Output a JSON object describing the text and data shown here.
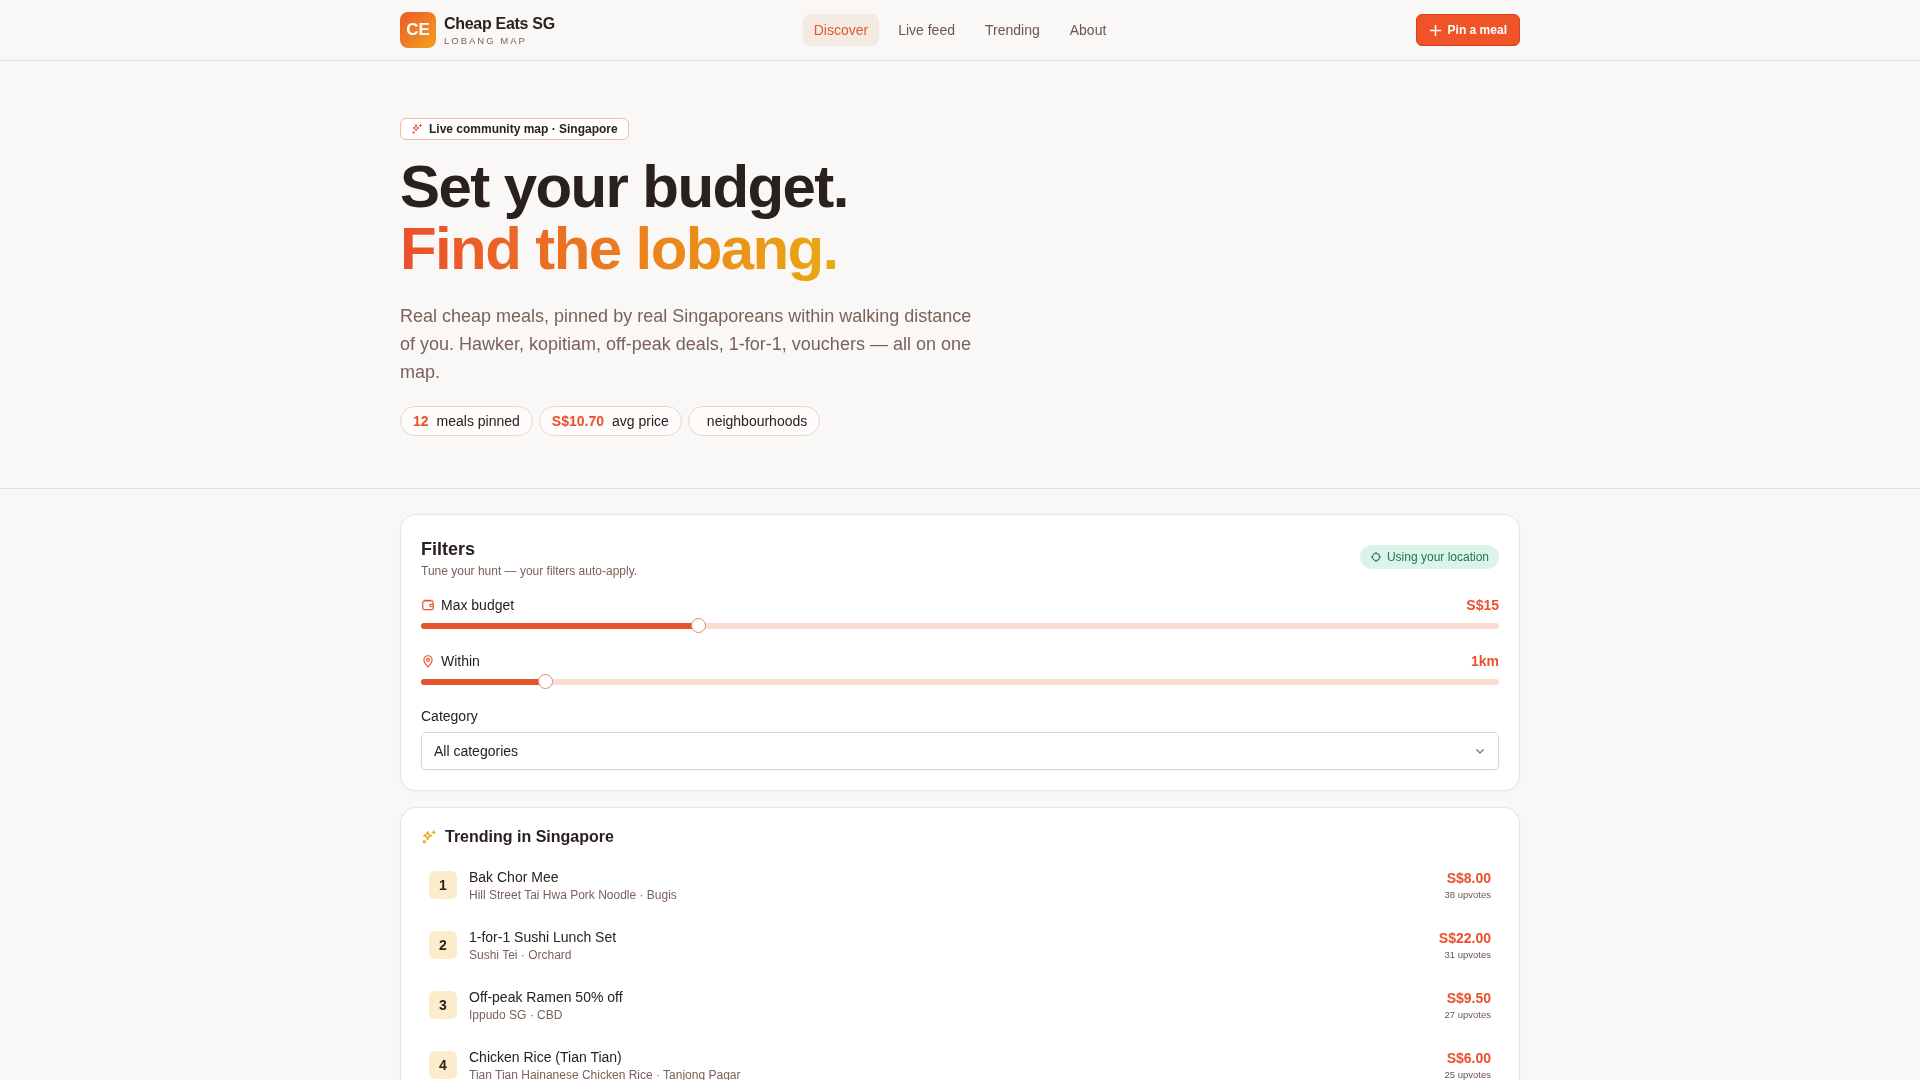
{
  "header": {
    "logo_initials": "CE",
    "brand": "Cheap Eats SG",
    "tagline": "LOBANG MAP",
    "nav": [
      {
        "label": "Discover",
        "selected": true
      },
      {
        "label": "Live feed",
        "selected": false
      },
      {
        "label": "Trending",
        "selected": false
      },
      {
        "label": "About",
        "selected": false
      }
    ],
    "action": "Pin a meal"
  },
  "hero": {
    "badge": "Live community map · Singapore",
    "title_line_1": "Set your budget.",
    "title_line_2": "Find the lobang.",
    "description": "Real cheap meals, pinned by real Singaporeans within walking distance of you. Hawker, kopitiam, off-peak deals, 1-for-1, vouchers — all on one map.",
    "stats": [
      {
        "value": "12",
        "label": "meals pinned"
      },
      {
        "value": "S$10.70",
        "label": "avg price"
      },
      {
        "label": "neighbourhoods"
      }
    ]
  },
  "filters": {
    "title": "Filters",
    "subtitle": "Tune your hunt — your filters auto-apply.",
    "location": "Using your location",
    "sliders": [
      {
        "kind": "wallet",
        "label": "Max budget",
        "reading": "S$15",
        "level": 0.258
      },
      {
        "kind": "pin",
        "label": "Within",
        "reading": "1km",
        "level": 0.116
      }
    ],
    "category_label": "Category",
    "category_value": "All categories"
  },
  "trending": {
    "title": "Trending in Singapore",
    "items": [
      {
        "rank": "1",
        "name": "Bak Chor Mee",
        "place": "Hill Street Tai Hwa Pork Noodle · Bugis",
        "price": "S$8.00",
        "votes": "38 upvotes"
      },
      {
        "rank": "2",
        "name": "1-for-1 Sushi Lunch Set",
        "place": "Sushi Tei · Orchard",
        "price": "S$22.00",
        "votes": "31 upvotes"
      },
      {
        "rank": "3",
        "name": "Off-peak Ramen 50% off",
        "place": "Ippudo SG · CBD",
        "price": "S$9.50",
        "votes": "27 upvotes"
      },
      {
        "rank": "4",
        "name": "Chicken Rice (Tian Tian)",
        "place": "Tian Tian Hainanese Chicken Rice · Tanjong Pagar",
        "price": "S$6.00",
        "votes": "25 upvotes"
      }
    ]
  }
}
